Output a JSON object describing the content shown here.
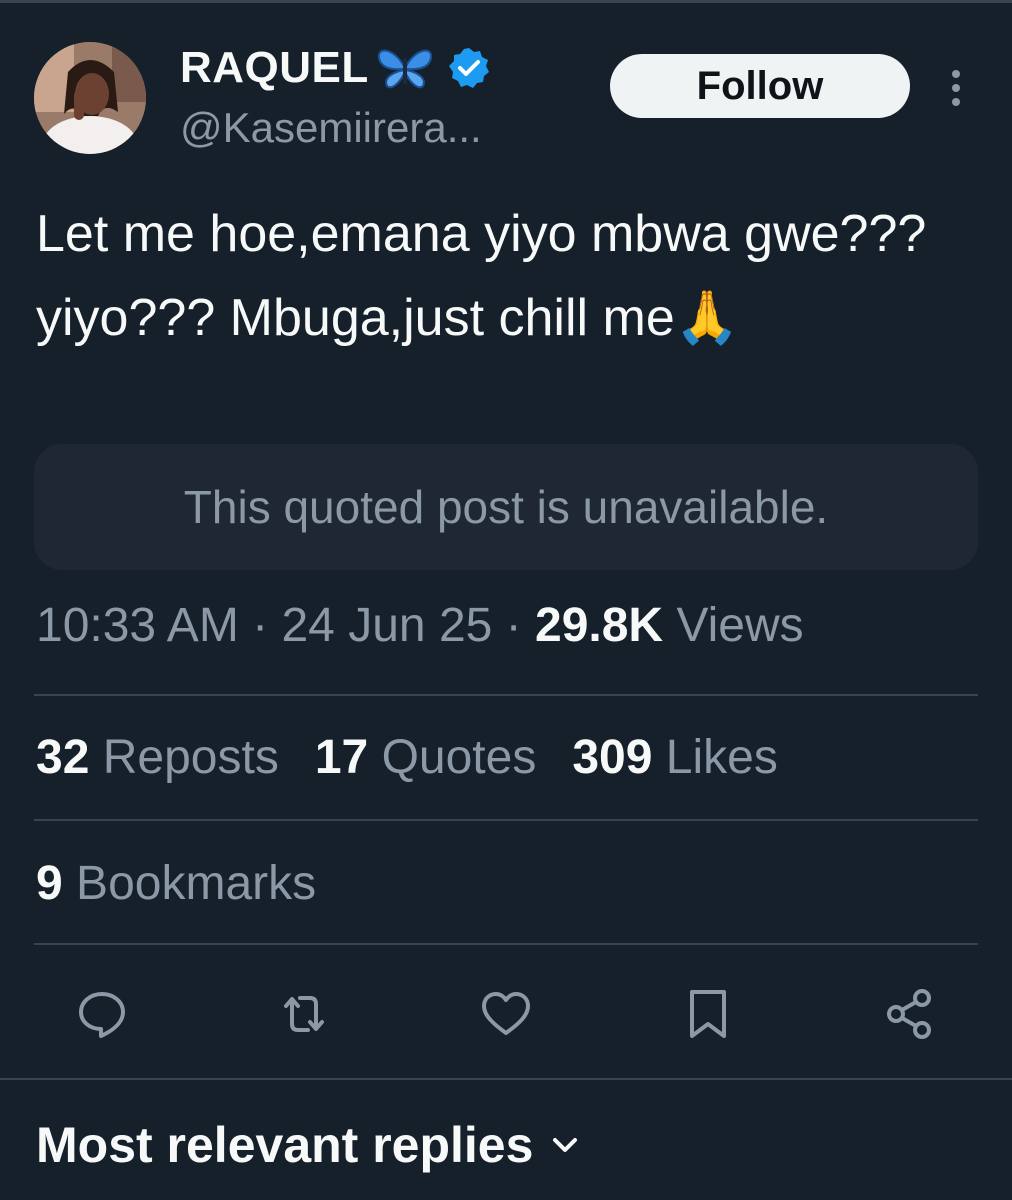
{
  "user": {
    "name": "RAQUEL",
    "handle": "@Kasemiirera..."
  },
  "follow_label": "Follow",
  "tweet": {
    "text": "Let me hoe,emana yiyo mbwa gwe???yiyo??? Mbuga,just chill me🙏",
    "quoted_unavailable": "This quoted post is unavailable."
  },
  "meta": {
    "time": "10:33 AM",
    "separator": "·",
    "date": "24 Jun 25",
    "views_count": "29.8K",
    "views_label": "Views"
  },
  "stats": {
    "reposts_count": "32",
    "reposts_label": "Reposts",
    "quotes_count": "17",
    "quotes_label": "Quotes",
    "likes_count": "309",
    "likes_label": "Likes",
    "bookmarks_count": "9",
    "bookmarks_label": "Bookmarks"
  },
  "actions": [
    "reply-icon",
    "retweet-icon",
    "like-icon",
    "bookmark-icon",
    "share-icon"
  ],
  "replies_sort_label": "Most relevant replies",
  "colors": {
    "background": "#15202b",
    "text_primary": "#f7f9f9",
    "text_secondary": "#8b98a5",
    "divider": "#38444d",
    "verified_blue": "#1d9bf0",
    "follow_bg": "#eff3f4"
  }
}
